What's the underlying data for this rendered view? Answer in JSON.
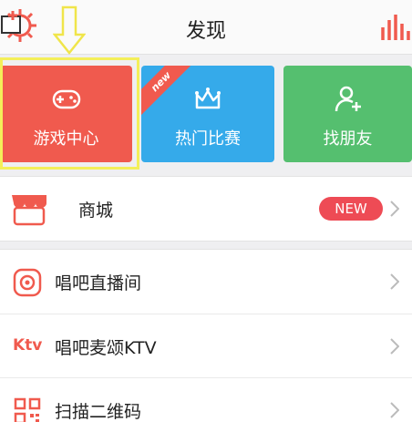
{
  "header": {
    "title": "发现"
  },
  "tiles": [
    {
      "label": "游戏中心",
      "icon": "gamepad-icon",
      "color": "#f05a4e"
    },
    {
      "label": "热门比赛",
      "icon": "crown-icon",
      "color": "#35aaea",
      "ribbon": "new"
    },
    {
      "label": "找朋友",
      "icon": "add-friend-icon",
      "color": "#55bf6f"
    }
  ],
  "shop": {
    "label": "商城",
    "badge": "NEW",
    "icon": "store-icon"
  },
  "menu": [
    {
      "label": "唱吧直播间",
      "icon": "live-icon"
    },
    {
      "label": "唱吧麦颂KTV",
      "icon": "ktv-icon",
      "icon_text": "Ktv"
    },
    {
      "label": "扫描二维码",
      "icon": "qrcode-icon"
    }
  ],
  "colors": {
    "accent": "#f05a4e",
    "highlight": "#f4ef5a",
    "badge": "#ee4b55"
  }
}
